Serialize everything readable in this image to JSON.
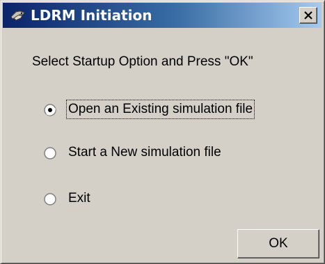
{
  "window": {
    "title": "LDRM Initiation",
    "icon": "app-logo-icon",
    "close_icon": "close-icon",
    "close_glyph": "X"
  },
  "dialog": {
    "prompt": "Select Startup Option and Press \"OK\"",
    "options": [
      {
        "label": "Open an Existing simulation file",
        "selected": true,
        "focused": true
      },
      {
        "label": "Start a New simulation file",
        "selected": false,
        "focused": false
      },
      {
        "label": "Exit",
        "selected": false,
        "focused": false
      }
    ],
    "ok_label": "OK"
  },
  "colors": {
    "titlebar_start": "#0a246a",
    "titlebar_end": "#a6caf0",
    "face": "#d4d0c8"
  }
}
